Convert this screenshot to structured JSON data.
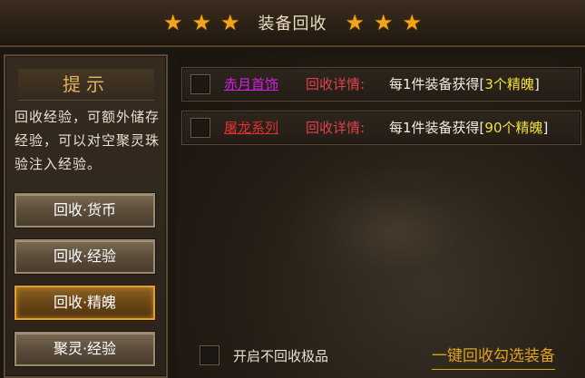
{
  "header": {
    "title": "装备回收",
    "left_stars": [
      "★",
      "★",
      "★"
    ],
    "right_stars": [
      "★",
      "★",
      "★"
    ],
    "star_color": "#f2a41a"
  },
  "tip_panel": {
    "title": "提示",
    "text": "回收经验，可额外储存经验，可以对空聚灵珠验注入经验。"
  },
  "categories": [
    {
      "label": "回收·货币",
      "active": false
    },
    {
      "label": "回收·经验",
      "active": false
    },
    {
      "label": "回收·精魄",
      "active": true
    },
    {
      "label": "聚灵·经验",
      "active": false
    }
  ],
  "recycle_rows": [
    {
      "name": "赤月首饰",
      "name_color": "#d020e0",
      "detail_label": "回收详情:",
      "detail_prefix": "每1件装备获得[",
      "detail_highlight": "3个精魄",
      "detail_suffix": "]"
    },
    {
      "name": "屠龙系列",
      "name_color": "#e03030",
      "detail_label": "回收详情:",
      "detail_prefix": "每1件装备获得[",
      "detail_highlight": "90个精魄",
      "detail_suffix": "]"
    }
  ],
  "footer": {
    "no_recycle_label": "开启不回收极品",
    "one_key_label": "一键回收勾选装备"
  },
  "colors": {
    "accent_gold": "#e0a020",
    "detail_red": "#e04050",
    "highlight_yellow": "#f0e040"
  }
}
